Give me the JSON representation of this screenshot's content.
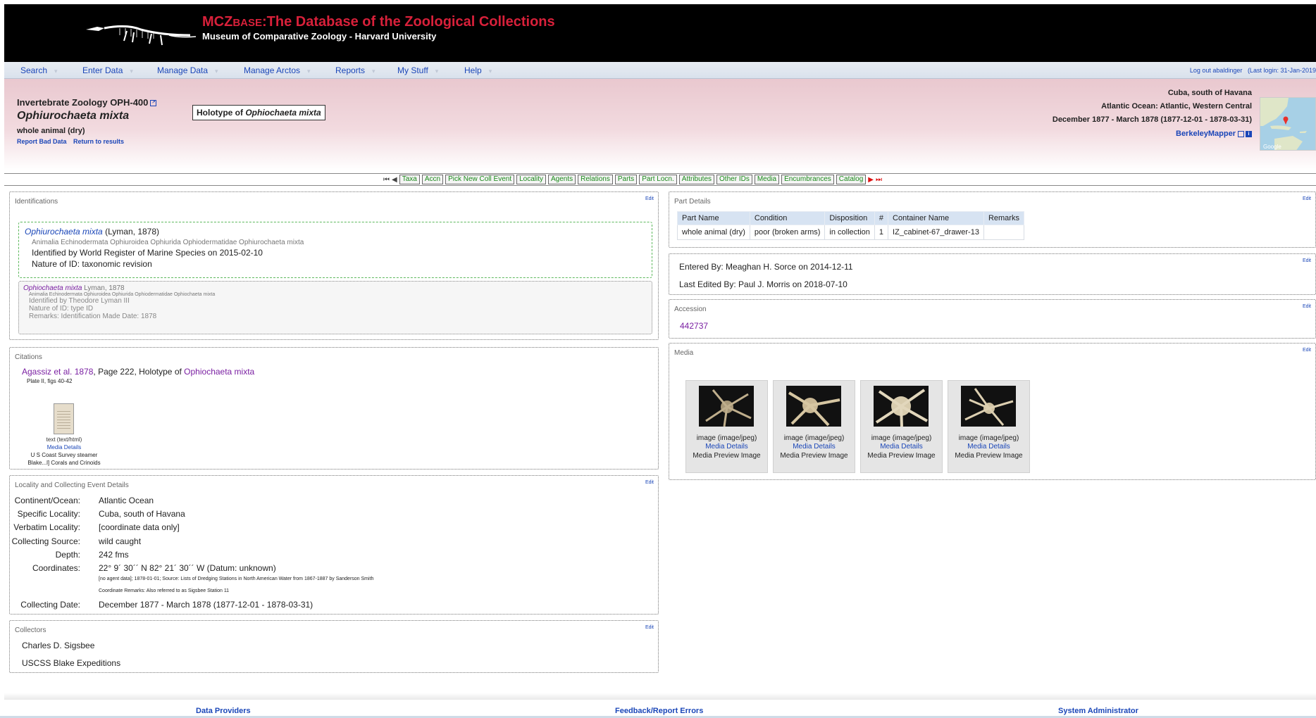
{
  "header": {
    "title_brand_main": "MCZ",
    "title_brand_small": "BASE",
    "title_rest": ":The Database of the Zoological Collections",
    "subtitle": "Museum of Comparative Zoology - Harvard University",
    "brand_color": "#d8203a"
  },
  "menu": {
    "items": [
      "Search",
      "Enter Data",
      "Manage Data",
      "Manage Arctos",
      "Reports",
      "My Stuff",
      "Help"
    ],
    "logout": "Log out abaldinger",
    "last_login": "(Last login: 31-Jan-2019"
  },
  "summary": {
    "collection_number": "Invertebrate Zoology OPH-400",
    "scientific_name": "Ophiurochaeta mixta",
    "part": "whole animal (dry)",
    "report_bad_data": "Report Bad Data",
    "return_to_results": "Return to results",
    "type_status_prefix": "Holotype of",
    "type_status_name": "Ophiochaeta mixta",
    "geo_specific": "Cuba, south of Havana",
    "geo_higher": "Atlantic Ocean: Atlantic, Western Central",
    "date": "December 1877 - March 1878 (1877-12-01 - 1878-03-31)",
    "mapper": "BerkeleyMapper",
    "map_credit": "Google"
  },
  "nav": {
    "buttons": [
      "Taxa",
      "Accn",
      "Pick New Coll Event",
      "Locality",
      "Agents",
      "Relations",
      "Parts",
      "Part Locn.",
      "Attributes",
      "Other IDs",
      "Media",
      "Encumbrances",
      "Catalog"
    ]
  },
  "identifications": {
    "title": "Identifications",
    "edit": "Edit",
    "current": {
      "name": "Ophiurochaeta mixta",
      "author": "(Lyman, 1878)",
      "taxonomy": "Animalia Echinodermata Ophiuroidea Ophiurida Ophiodermatidae Ophiurochaeta mixta",
      "identified_by": "Identified by World Register of Marine Species on 2015-02-10",
      "nature": "Nature of ID: taxonomic revision"
    },
    "previous": {
      "name": "Ophiochaeta mixta",
      "author": "Lyman, 1878",
      "taxonomy": "Animalia Echinodermata Ophiuroidea Ophiurida Ophiodermatidae Ophiochaeta mixta",
      "identified_by": "Identified by Theodore Lyman III",
      "nature": "Nature of ID: type ID",
      "remarks": "Remarks: Identification Made Date: 1878"
    }
  },
  "citations": {
    "title": "Citations",
    "ref": "Agassiz et al. 1878",
    "detail": ", Page 222, Holotype of ",
    "taxon": "Ophiochaeta mixta",
    "plate": "Plate II, figs 40-42",
    "media_type": "text (text/html)",
    "media_details": "Media Details",
    "caption1": "U S Coast Survey steamer",
    "caption2": "Blake...l] Corals and Crinoids"
  },
  "locality": {
    "title": "Locality and Collecting Event Details",
    "edit": "Edit",
    "rows": [
      {
        "label": "Continent/Ocean:",
        "value": "Atlantic Ocean"
      },
      {
        "label": "Specific Locality:",
        "value": "Cuba, south of Havana"
      },
      {
        "label": "Verbatim Locality:",
        "value": "[coordinate data only]"
      },
      {
        "label": "Collecting Source:",
        "value": "wild caught"
      },
      {
        "label": "Depth:",
        "value": "242 fms"
      },
      {
        "label": "Coordinates:",
        "value": "22° 9´ 30´´ N 82° 21´ 30´´ W (Datum: unknown)"
      }
    ],
    "coord_note1": "[no agent data]; 1878-01-01; Source: Lists of Dredging Stations in North American Water from 1867-1887 by Sanderson Smith",
    "coord_note2": "Coordinate Remarks: Also referred to as Sigsbee Station 11",
    "date_label": "Collecting Date:",
    "date_value": "December 1877 - March 1878 (1877-12-01 - 1878-03-31)"
  },
  "collectors": {
    "title": "Collectors",
    "edit": "Edit",
    "names": [
      "Charles D. Sigsbee",
      "USCSS Blake Expeditions"
    ]
  },
  "parts": {
    "title": "Part Details",
    "edit": "Edit",
    "headers": [
      "Part Name",
      "Condition",
      "Disposition",
      "#",
      "Container Name",
      "Remarks"
    ],
    "rows": [
      [
        "whole animal (dry)",
        "poor (broken arms)",
        "in collection",
        "1",
        "IZ_cabinet-67_drawer-13",
        ""
      ]
    ]
  },
  "entered": {
    "edit": "Edit",
    "entered_by": "Entered By: Meaghan H. Sorce on 2014-12-11",
    "last_edited": "Last Edited By: Paul J. Morris on 2018-07-10"
  },
  "accession": {
    "title": "Accession",
    "edit": "Edit",
    "number": "442737"
  },
  "media": {
    "title": "Media",
    "edit": "Edit",
    "items": [
      {
        "type": "image (image/jpeg)",
        "details": "Media Details",
        "preview": "Media Preview Image"
      },
      {
        "type": "image (image/jpeg)",
        "details": "Media Details",
        "preview": "Media Preview Image"
      },
      {
        "type": "image (image/jpeg)",
        "details": "Media Details",
        "preview": "Media Preview Image"
      },
      {
        "type": "image (image/jpeg)",
        "details": "Media Details",
        "preview": "Media Preview Image"
      }
    ]
  },
  "footer": {
    "data_providers": "Data Providers",
    "feedback": "Feedback/Report Errors",
    "sysadmin": "System Administrator"
  }
}
